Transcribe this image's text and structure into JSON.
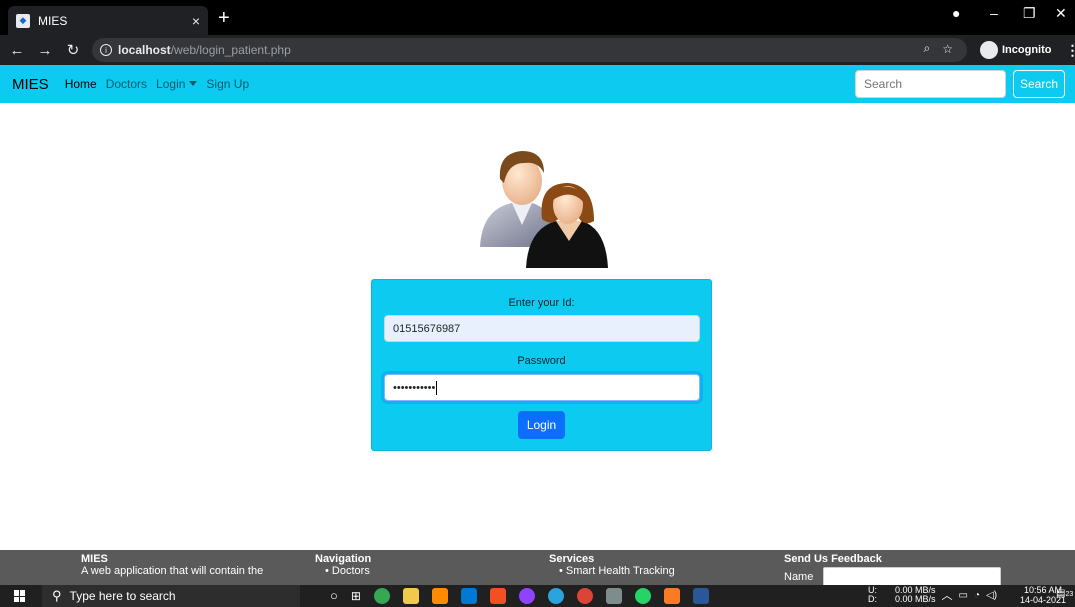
{
  "browser": {
    "tab_title": "MIES",
    "tab_close": "×",
    "new_tab": "+",
    "url_host": "localhost",
    "url_path": "/web/login_patient.php",
    "incognito_label": "Incognito"
  },
  "navbar": {
    "brand": "MIES",
    "links": [
      "Home",
      "Doctors",
      "Login",
      "Sign Up"
    ],
    "search_placeholder": "Search",
    "search_button": "Search"
  },
  "login": {
    "id_label": "Enter your Id:",
    "id_value": "01515676987",
    "password_label": "Password",
    "password_value": "•••••••••••",
    "button": "Login"
  },
  "footer": {
    "brand": "MIES",
    "brand_desc": "A web application that will contain the",
    "nav_heading": "Navigation",
    "nav_item": "Doctors",
    "services_heading": "Services",
    "services_item": "Smart Health Tracking",
    "feedback_heading": "Send Us Feedback",
    "feedback_name_label": "Name"
  },
  "taskbar": {
    "search_placeholder": "Type here to search",
    "net_up_label": "U:",
    "net_down_label": "D:",
    "net_up": "0.00 MB/s",
    "net_down": "0.00 MB/s",
    "time": "10:56 AM",
    "date": "14-04-2021",
    "notifications": "23"
  },
  "colors": {
    "navbar": "#0dcaf0",
    "primary": "#0d6efd",
    "footer": "#5a5a5a"
  }
}
